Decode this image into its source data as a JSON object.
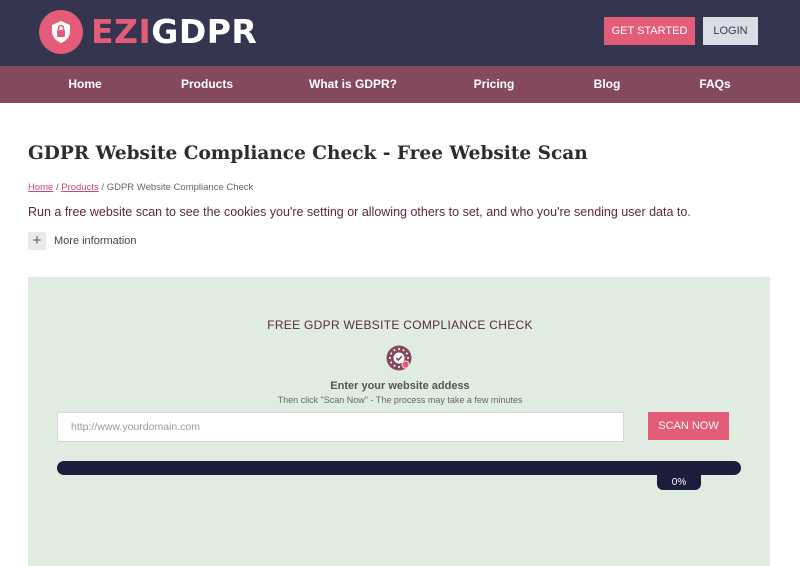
{
  "brand": {
    "logo_prefix": "EZI",
    "logo_suffix": "GDPR",
    "accent_color": "#e35d78",
    "header_color": "#36354f",
    "nav_color": "#85495e"
  },
  "header": {
    "get_started_label": "GET STARTED",
    "login_label": "LOGIN"
  },
  "nav": {
    "items": [
      "Home",
      "Products",
      "What is GDPR?",
      "Pricing",
      "Blog",
      "FAQs"
    ]
  },
  "page": {
    "title": "GDPR Website Compliance Check - Free Website Scan",
    "breadcrumb": {
      "home": "Home",
      "products": "Products",
      "separator": "/",
      "current": "GDPR Website Compliance Check"
    },
    "intro": "Run a free website scan to see the cookies you're setting or allowing others to set, and who you're sending user data to.",
    "more_info_label": "More information",
    "more_info_icon": "+"
  },
  "scan": {
    "title": "FREE GDPR WEBSITE COMPLIANCE CHECK",
    "icon": "gdpr-check-icon",
    "enter_label": "Enter your website addess",
    "sub_label": "Then click \"Scan Now\" - The process may take a few minutes",
    "url_placeholder": "http://www.yourdomain.com",
    "url_value": "",
    "scan_button_label": "SCAN NOW",
    "progress_percent": 0,
    "progress_label": "0%"
  }
}
